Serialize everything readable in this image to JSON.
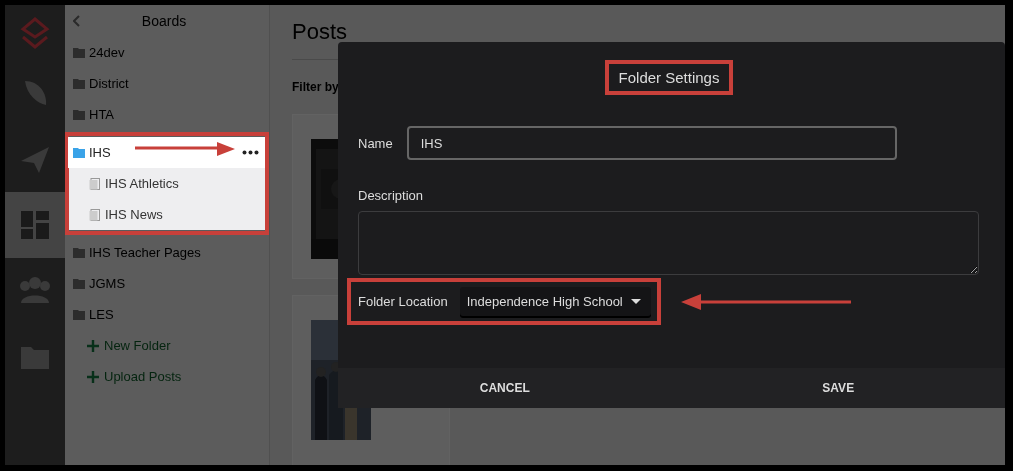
{
  "nav_rail": {
    "items": [
      {
        "kind": "feather",
        "selected": false
      },
      {
        "kind": "plane",
        "selected": false
      },
      {
        "kind": "dashboard",
        "selected": true
      },
      {
        "kind": "people",
        "selected": false
      },
      {
        "kind": "folder",
        "selected": false
      }
    ]
  },
  "sidebar": {
    "title": "Boards",
    "folders": [
      {
        "label": "24dev",
        "selected": false
      },
      {
        "label": "District",
        "selected": false
      },
      {
        "label": "HTA",
        "selected": false
      },
      {
        "label": "IHS",
        "selected": true,
        "highlighted": true,
        "arrow": true,
        "children": [
          {
            "label": "IHS Athletics"
          },
          {
            "label": "IHS News"
          }
        ]
      },
      {
        "label": "IHS Teacher Pages",
        "selected": false
      },
      {
        "label": "JGMS",
        "selected": false
      },
      {
        "label": "LES",
        "selected": false
      }
    ],
    "actions": [
      "New Folder",
      "Upload Posts"
    ]
  },
  "main": {
    "title": "Posts",
    "filter_label": "Filter by"
  },
  "dialog": {
    "title": "Folder Settings",
    "title_highlighted": true,
    "fields": [
      {
        "kind": "text",
        "label": "Name",
        "value": "IHS"
      },
      {
        "kind": "textarea",
        "label": "Description"
      },
      {
        "kind": "select",
        "label": "Folder Location",
        "value": "Independence High School",
        "highlighted": true,
        "arrow": true
      }
    ],
    "buttons": [
      "CANCEL",
      "SAVE"
    ]
  }
}
